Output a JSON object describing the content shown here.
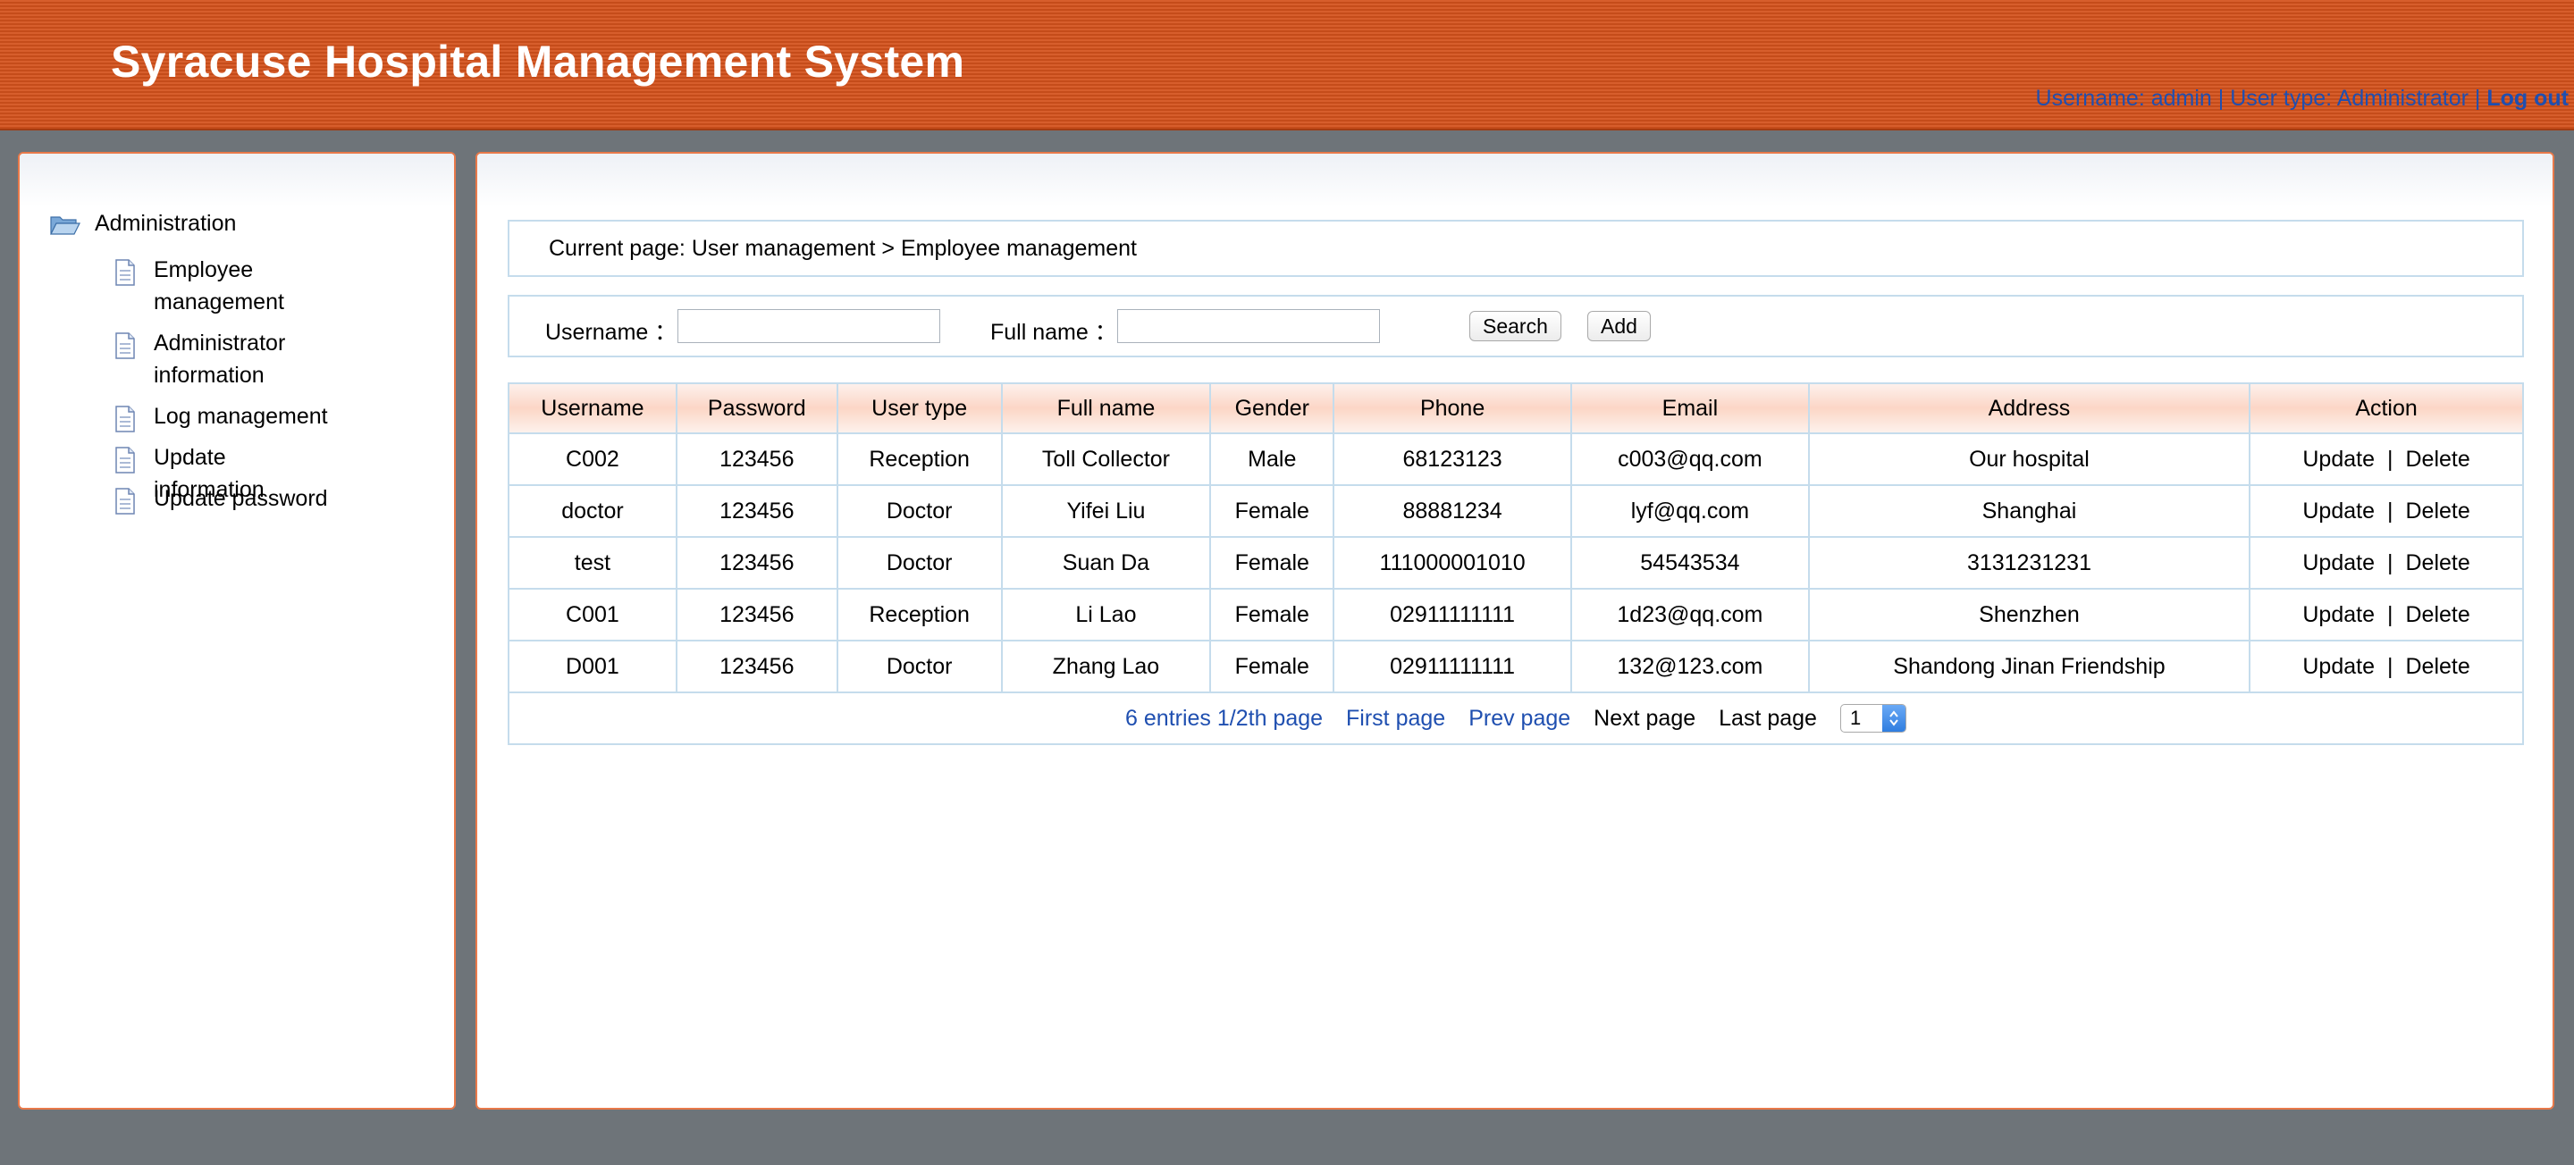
{
  "header": {
    "title": "Syracuse Hospital Management System",
    "user_info": "Username: admin | User type: Administrator | ",
    "logout_label": "Log out"
  },
  "sidebar": {
    "root_label": "Administration",
    "items": [
      {
        "label": "Employee management"
      },
      {
        "label": "Administrator information"
      },
      {
        "label": "Log management"
      },
      {
        "label": "Update information"
      },
      {
        "label": "Update password"
      }
    ]
  },
  "breadcrumb": "Current page: User management > Employee management",
  "search": {
    "username_label": "Username ：",
    "fullname_label": "Full name ：",
    "username_value": "",
    "fullname_value": "",
    "search_label": "Search",
    "add_label": "Add"
  },
  "table": {
    "columns": [
      "Username",
      "Password",
      "User type",
      "Full name",
      "Gender",
      "Phone",
      "Email",
      "Address",
      "Action"
    ],
    "rows": [
      [
        "C002",
        "123456",
        "Reception",
        "Toll Collector",
        "Male",
        "68123123",
        "c003@qq.com",
        "Our hospital"
      ],
      [
        "doctor",
        "123456",
        "Doctor",
        "Yifei Liu",
        "Female",
        "88881234",
        "lyf@qq.com",
        "Shanghai"
      ],
      [
        "test",
        "123456",
        "Doctor",
        "Suan Da",
        "Female",
        "111000001010",
        "54543534",
        "3131231231"
      ],
      [
        "C001",
        "123456",
        "Reception",
        "Li Lao",
        "Female",
        "02911111111",
        "1d23@qq.com",
        "Shenzhen"
      ],
      [
        "D001",
        "123456",
        "Doctor",
        "Zhang Lao",
        "Female",
        "02911111111",
        "132@123.com",
        "Shandong Jinan Friendship"
      ]
    ],
    "update_label": "Update",
    "separator": "|",
    "delete_label": "Delete"
  },
  "pager": {
    "info": "6 entries  1/2th page",
    "first": "First page",
    "prev": "Prev page",
    "next": "Next page",
    "last": "Last page",
    "page_select": "1"
  },
  "colors": {
    "header_bg": "#d4521c",
    "link_blue": "#1f4fb0",
    "table_border": "#c5dcec",
    "panel_border": "#e8794a"
  }
}
